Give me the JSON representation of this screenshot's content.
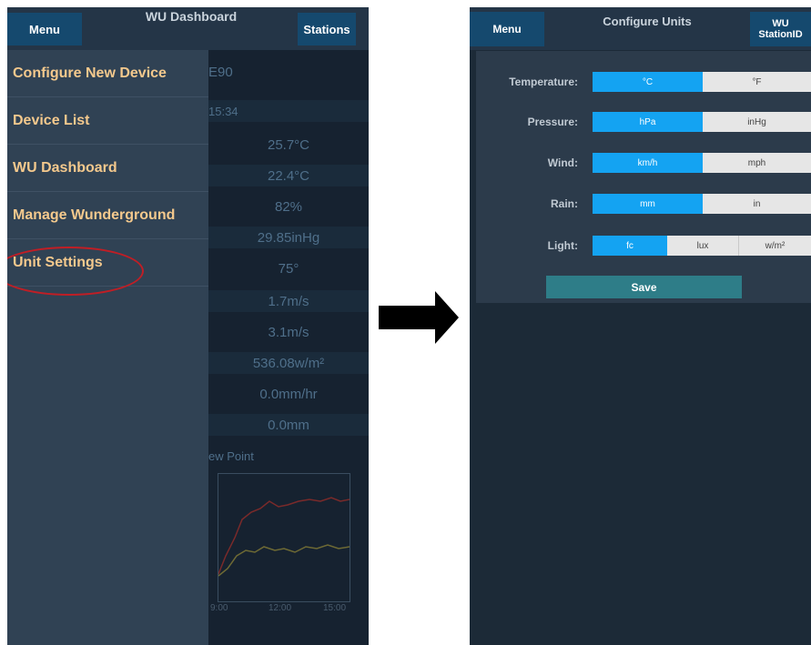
{
  "left_screen": {
    "menu_label": "Menu",
    "title": "WU Dashboard",
    "stations_label": "Stations",
    "drawer_items": [
      {
        "label": "Configure New Device"
      },
      {
        "label": "Device List"
      },
      {
        "label": "WU Dashboard"
      },
      {
        "label": "Manage Wunderground"
      },
      {
        "label": "Unit Settings"
      }
    ],
    "background_values": [
      "E90",
      "15:34",
      "25.7°C",
      "22.4°C",
      "82%",
      "29.85inHg",
      "75°",
      "1.7m/s",
      "3.1m/s",
      "536.08w/m²",
      "0.0mm/hr",
      "0.0mm"
    ],
    "chart_title_fragment": "ew Point",
    "chart_x_ticks": [
      "9:00",
      "12:00",
      "15:00"
    ]
  },
  "right_screen": {
    "menu_label": "Menu",
    "title": "Configure Units",
    "station_label_line1": "WU",
    "station_label_line2": "StationID",
    "rows": [
      {
        "label": "Temperature:",
        "options": [
          "°C",
          "°F"
        ],
        "selected": 0
      },
      {
        "label": "Pressure:",
        "options": [
          "hPa",
          "inHg"
        ],
        "selected": 0
      },
      {
        "label": "Wind:",
        "options": [
          "km/h",
          "mph"
        ],
        "selected": 0
      },
      {
        "label": "Rain:",
        "options": [
          "mm",
          "in"
        ],
        "selected": 0
      },
      {
        "label": "Light:",
        "options": [
          "fc",
          "lux",
          "w/m²"
        ],
        "selected": 0
      }
    ],
    "save_label": "Save"
  },
  "colors": {
    "accent_blue": "#14a3f2",
    "drawer_text": "#f4c98d",
    "highlight_red": "#c01e25",
    "save_button": "#2e7d88"
  }
}
